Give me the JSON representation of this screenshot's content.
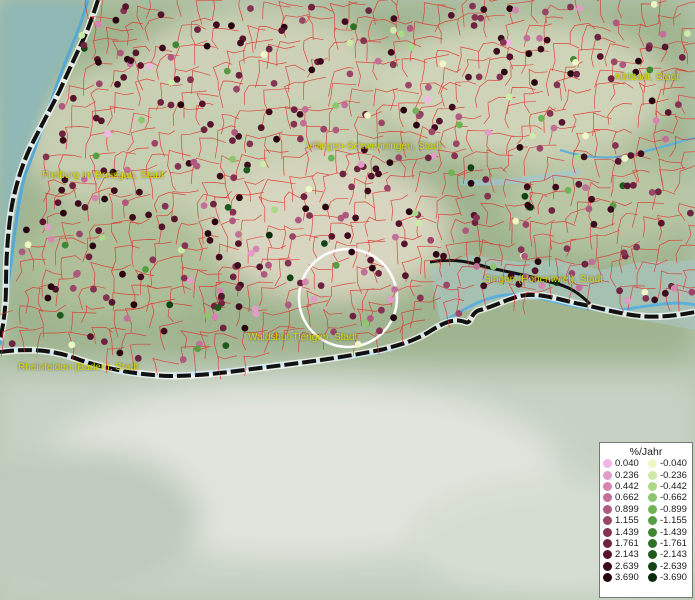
{
  "map": {
    "cities": [
      {
        "name": "Albstadt, Stadt"
      },
      {
        "name": "Villingen-Schwenningen, Stadt"
      },
      {
        "name": "Freiburg im Breisgau, Stadt"
      },
      {
        "name": "Singen (Hohentwiel), Stadt"
      },
      {
        "name": "Waldshut-Tiengen, Stadt"
      },
      {
        "name": "Rheinfelden (Baden), Stadt"
      }
    ],
    "legend": {
      "title": "%/Jahr",
      "positive": [
        {
          "label": "0.040",
          "color": "#f2b6e6"
        },
        {
          "label": "0.236",
          "color": "#e29cc8"
        },
        {
          "label": "0.442",
          "color": "#d486b0"
        },
        {
          "label": "0.662",
          "color": "#c26f99"
        },
        {
          "label": "0.899",
          "color": "#ae5a80"
        },
        {
          "label": "1.155",
          "color": "#9a4668"
        },
        {
          "label": "1.439",
          "color": "#843352"
        },
        {
          "label": "1.761",
          "color": "#6e2340"
        },
        {
          "label": "2.143",
          "color": "#56152d"
        },
        {
          "label": "2.639",
          "color": "#3e0a1d"
        },
        {
          "label": "3.690",
          "color": "#280410"
        }
      ],
      "negative": [
        {
          "label": "-0.040",
          "color": "#eef8c4"
        },
        {
          "label": "-0.236",
          "color": "#cdeaa8"
        },
        {
          "label": "-0.442",
          "color": "#abd98a"
        },
        {
          "label": "-0.662",
          "color": "#8cc66e"
        },
        {
          "label": "-0.899",
          "color": "#6fb356"
        },
        {
          "label": "-1.155",
          "color": "#559f42"
        },
        {
          "label": "-1.439",
          "color": "#3e8832"
        },
        {
          "label": "-1.761",
          "color": "#2b7126"
        },
        {
          "label": "-2.143",
          "color": "#1d5a1c"
        },
        {
          "label": "-2.639",
          "color": "#124414"
        },
        {
          "label": "-3.690",
          "color": "#092e0b"
        }
      ]
    }
  }
}
